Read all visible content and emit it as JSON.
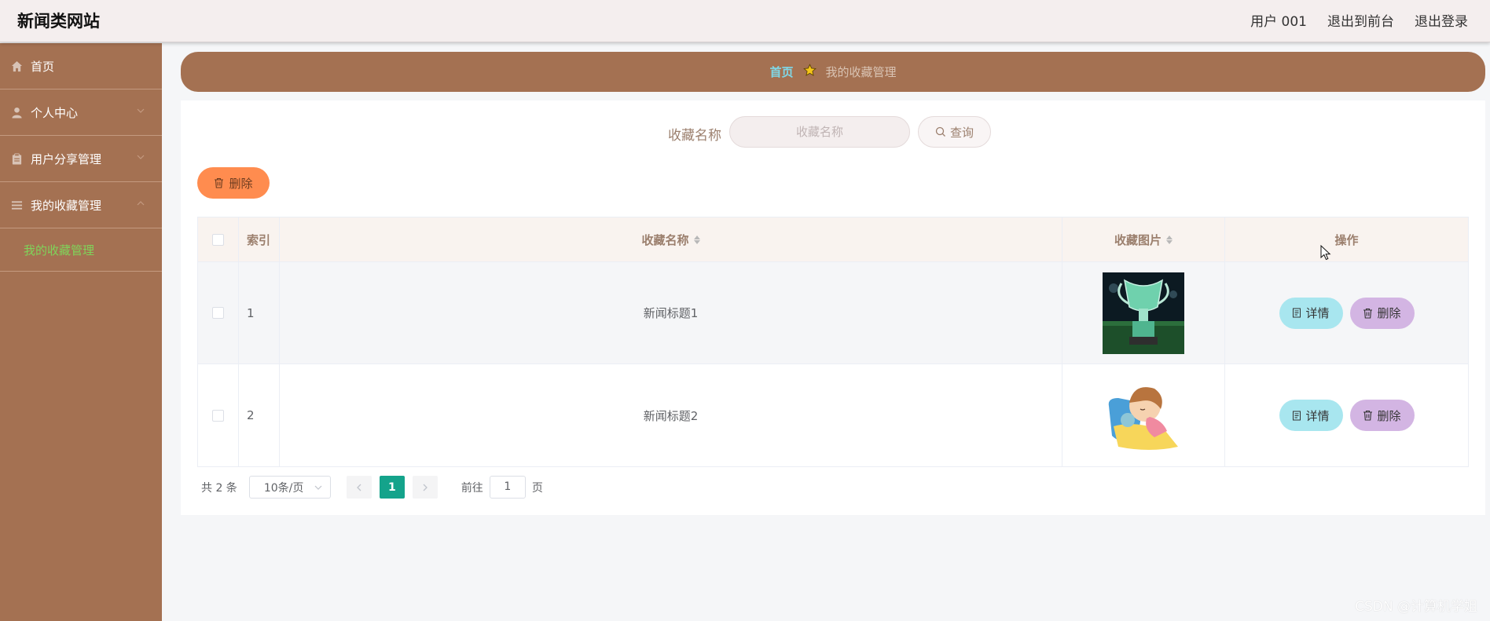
{
  "header": {
    "brand": "新闻类网站",
    "user_label": "用户 001",
    "exit_front_label": "退出到前台",
    "logout_label": "退出登录"
  },
  "sidebar": {
    "items": [
      {
        "label": "首页",
        "icon": "home-icon"
      },
      {
        "label": "个人中心",
        "icon": "user-icon"
      },
      {
        "label": "用户分享管理",
        "icon": "clipboard-icon"
      },
      {
        "label": "我的收藏管理",
        "icon": "list-icon"
      }
    ],
    "active_sub": "我的收藏管理"
  },
  "breadcrumb": {
    "home": "首页",
    "current": "我的收藏管理"
  },
  "search": {
    "label": "收藏名称",
    "placeholder": "收藏名称",
    "button_label": "查询"
  },
  "toolbar": {
    "delete_label": "删除"
  },
  "table": {
    "headers": {
      "index": "索引",
      "name": "收藏名称",
      "image": "收藏图片",
      "actions": "操作"
    },
    "rows": [
      {
        "index": "1",
        "name": "新闻标题1",
        "detail_label": "详情",
        "delete_label": "删除"
      },
      {
        "index": "2",
        "name": "新闻标题2",
        "detail_label": "详情",
        "delete_label": "删除"
      }
    ]
  },
  "pagination": {
    "total": "共 2 条",
    "page_size": "10条/页",
    "current_page": "1",
    "goto_prefix": "前往",
    "goto_value": "1",
    "goto_suffix": "页"
  },
  "watermark": "CSDN @计算机学姐",
  "colors": {
    "sidebar": "#a47152",
    "accent_green": "#14a38b",
    "delete_orange": "#ff8c4f",
    "detail_cyan": "#a8e6ef",
    "delete_purple": "#d3b5e3"
  }
}
